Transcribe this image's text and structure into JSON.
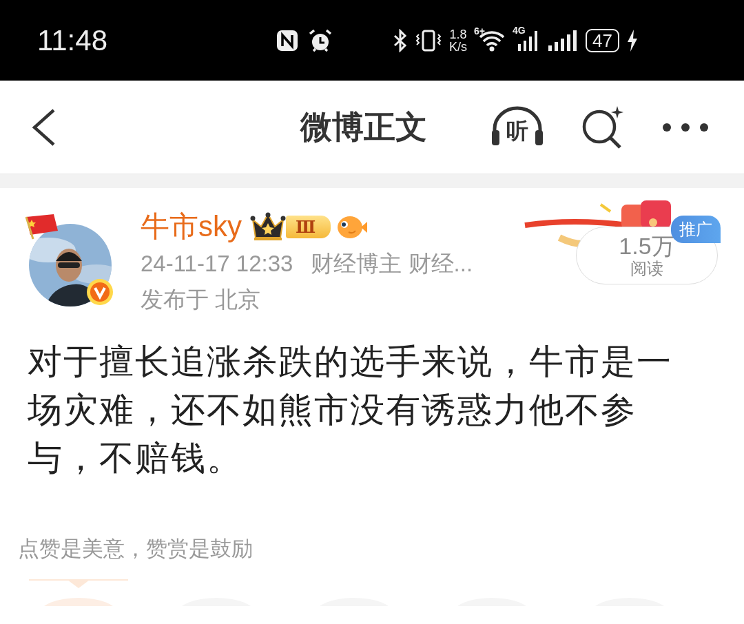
{
  "status_bar": {
    "time": "11:48",
    "speed_value": "1.8",
    "speed_unit": "K/s",
    "wifi_badge": "6+",
    "network": "4G",
    "battery": "47"
  },
  "header": {
    "title": "微博正文",
    "listen_label": "听"
  },
  "post": {
    "author": "牛市sky",
    "level_badge": "Ⅲ",
    "date": "24-11-17 12:33",
    "tags": "财经博主 财经...",
    "location": "发布于 北京",
    "read_count": "1.5万",
    "read_label": "阅读",
    "ad_label": "推广",
    "body": "对于擅长追涨杀跌的选手来说，牛市是一场灾难，还不如熊市没有诱惑力他不参与，不赔钱。"
  },
  "reward": {
    "prompt": "点赞是美意，赞赏是鼓励"
  }
}
